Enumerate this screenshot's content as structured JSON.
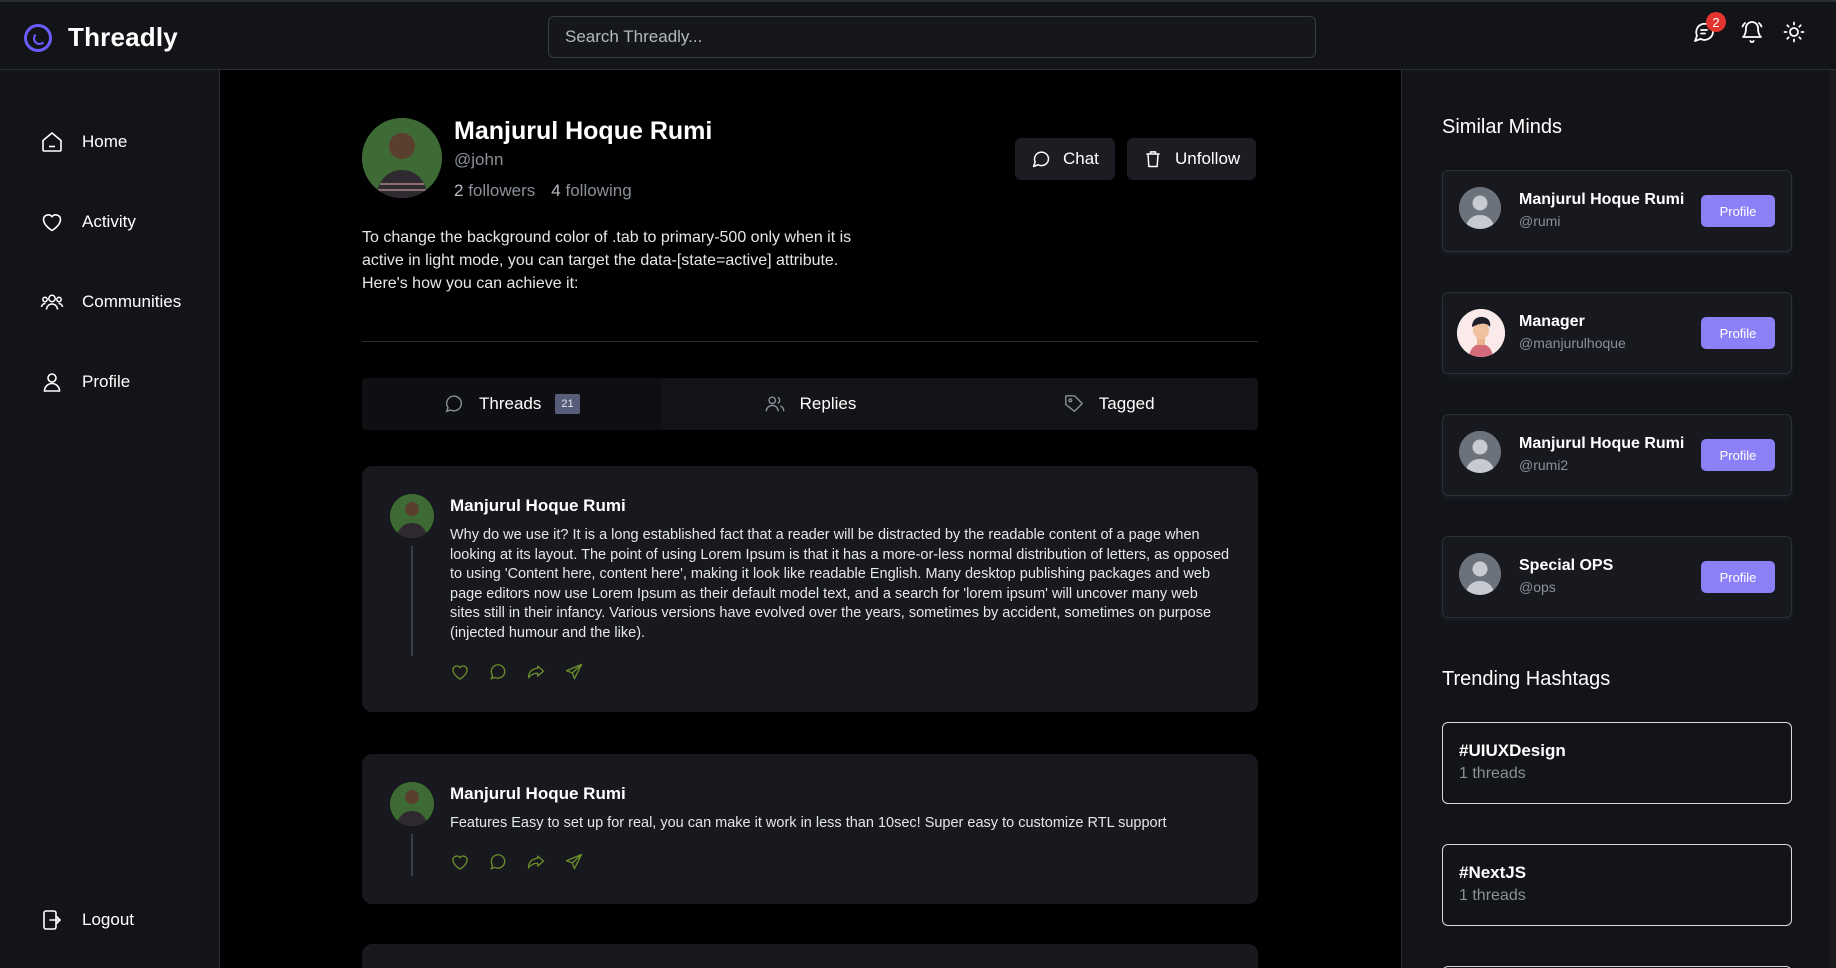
{
  "app": {
    "name": "Threadly"
  },
  "search": {
    "placeholder": "Search Threadly..."
  },
  "topbar": {
    "message_badge": "2"
  },
  "nav": {
    "items": [
      {
        "label": "Home",
        "icon": "home-icon"
      },
      {
        "label": "Activity",
        "icon": "heart-icon"
      },
      {
        "label": "Communities",
        "icon": "users-icon"
      },
      {
        "label": "Profile",
        "icon": "user-icon"
      }
    ],
    "logout": "Logout"
  },
  "profile": {
    "name": "Manjurul Hoque Rumi",
    "handle": "@john",
    "followers_count": "2",
    "followers_label": "followers",
    "following_count": "4",
    "following_label": "following",
    "bio": "To change the background color of .tab to primary-500 only when it is active in light mode, you can target the data-[state=active] attribute. Here's how you can achieve it:",
    "chat_label": "Chat",
    "unfollow_label": "Unfollow"
  },
  "tabs": [
    {
      "label": "Threads",
      "count": "21",
      "icon": "thread-icon"
    },
    {
      "label": "Replies",
      "icon": "users-icon"
    },
    {
      "label": "Tagged",
      "icon": "tag-icon"
    }
  ],
  "threads": [
    {
      "author": "Manjurul Hoque Rumi",
      "text": "Why do we use it? It is a long established fact that a reader will be distracted by the readable content of a page when looking at its layout. The point of using Lorem Ipsum is that it has a more-or-less normal distribution of letters, as opposed to using 'Content here, content here', making it look like readable English. Many desktop publishing packages and web page editors now use Lorem Ipsum as their default model text, and a search for 'lorem ipsum' will uncover many web sites still in their infancy. Various versions have evolved over the years, sometimes by accident, sometimes on purpose (injected humour and the like)."
    },
    {
      "author": "Manjurul Hoque Rumi",
      "text": "Features Easy to set up for real, you can make it work in less than 10sec! Super easy to customize RTL support"
    }
  ],
  "similar_minds": {
    "title": "Similar Minds",
    "button_label": "Profile",
    "users": [
      {
        "name": "Manjurul Hoque Rumi",
        "handle": "@rumi"
      },
      {
        "name": "Manager",
        "handle": "@manjurulhoque"
      },
      {
        "name": "Manjurul Hoque Rumi",
        "handle": "@rumi2"
      },
      {
        "name": "Special OPS",
        "handle": "@ops"
      }
    ]
  },
  "trending": {
    "title": "Trending Hashtags",
    "tags": [
      {
        "name": "#UIUXDesign",
        "count": "1 threads"
      },
      {
        "name": "#NextJS",
        "count": "1 threads"
      }
    ]
  },
  "colors": {
    "accent": "#8b80f7",
    "logo": "#6b5cff",
    "badge": "#e3342f",
    "thread_action": "#6b8e2a"
  }
}
